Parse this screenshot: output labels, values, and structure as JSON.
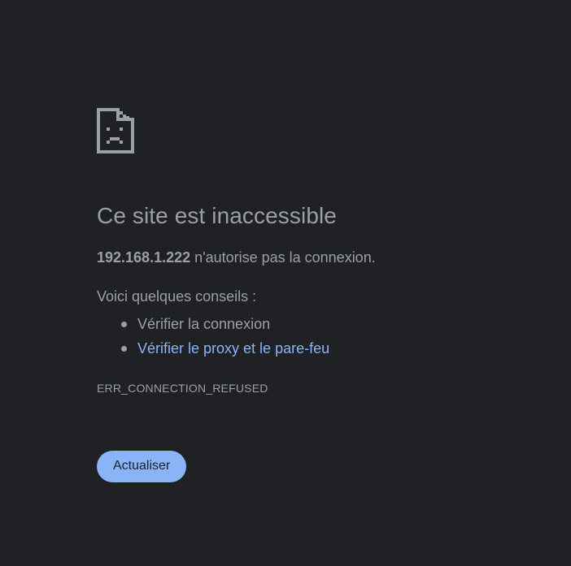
{
  "error": {
    "icon": "sad-page-icon",
    "title": "Ce site est inaccessible",
    "host": "192.168.1.222",
    "message_suffix": " n'autorise pas la connexion.",
    "suggestions_intro": "Voici quelques conseils :",
    "suggestions": [
      {
        "label": "Vérifier la connexion",
        "is_link": false
      },
      {
        "label": "Vérifier le proxy et le pare-feu",
        "is_link": true
      }
    ],
    "code": "ERR_CONNECTION_REFUSED",
    "reload_label": "Actualiser"
  },
  "colors": {
    "background": "#202124",
    "text": "#9aa0a6",
    "link": "#8ab4f8",
    "button": "#8ab4f8",
    "button_text": "#202124"
  }
}
